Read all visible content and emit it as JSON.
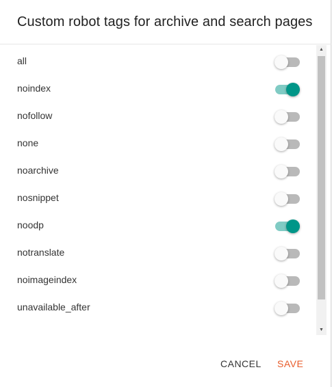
{
  "dialog": {
    "title": "Custom robot tags for archive and search pages"
  },
  "tags": [
    {
      "label": "all",
      "enabled": false
    },
    {
      "label": "noindex",
      "enabled": true
    },
    {
      "label": "nofollow",
      "enabled": false
    },
    {
      "label": "none",
      "enabled": false
    },
    {
      "label": "noarchive",
      "enabled": false
    },
    {
      "label": "nosnippet",
      "enabled": false
    },
    {
      "label": "noodp",
      "enabled": true
    },
    {
      "label": "notranslate",
      "enabled": false
    },
    {
      "label": "noimageindex",
      "enabled": false
    },
    {
      "label": "unavailable_after",
      "enabled": false
    }
  ],
  "actions": {
    "cancel_label": "CANCEL",
    "save_label": "SAVE"
  },
  "colors": {
    "accent_on": "#009688",
    "save": "#e85c2b"
  },
  "icons": {
    "scroll_up": "▲",
    "scroll_down": "▼"
  }
}
